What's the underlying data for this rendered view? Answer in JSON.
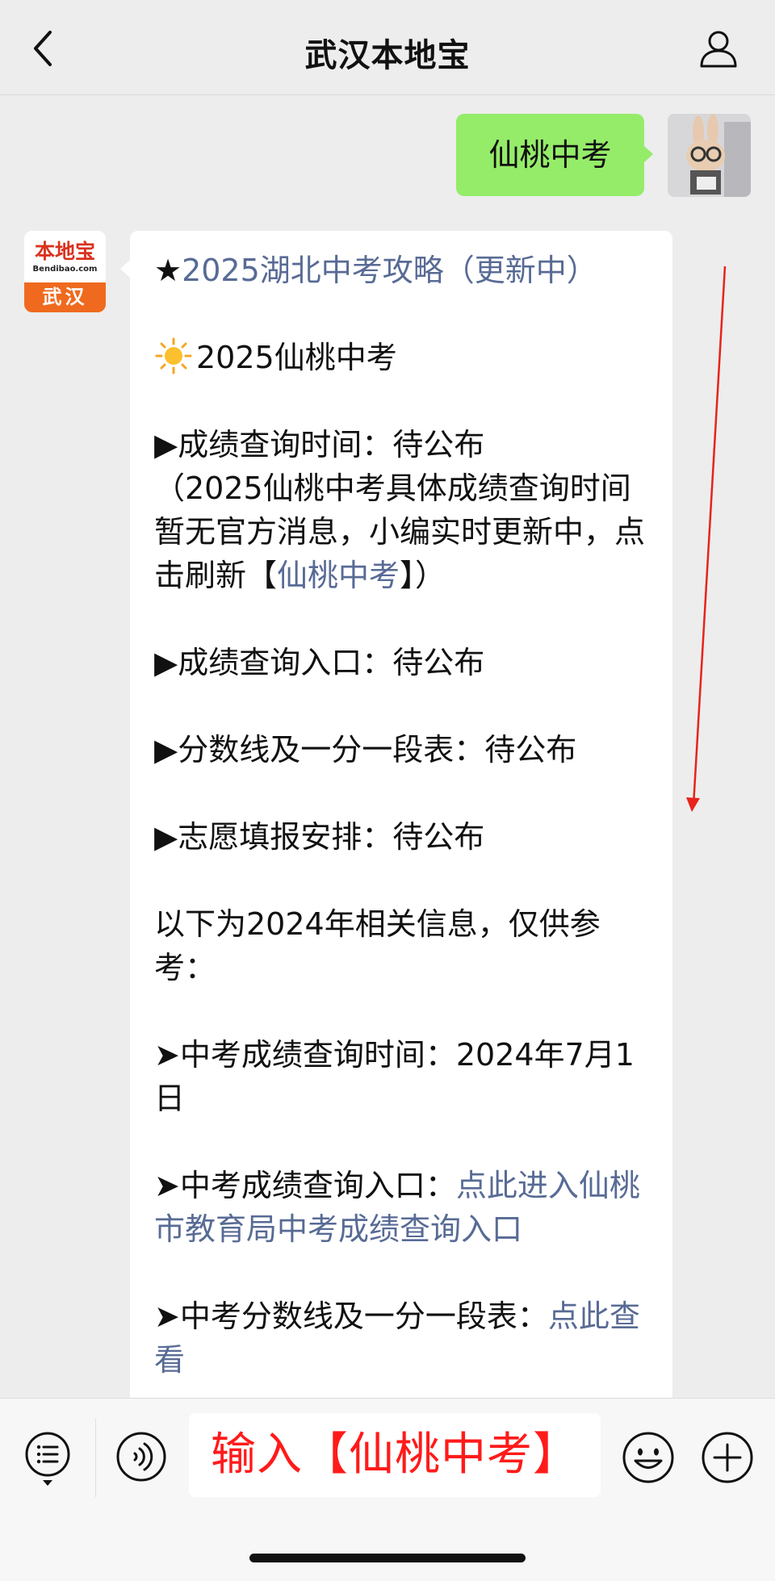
{
  "header": {
    "title": "武汉本地宝"
  },
  "outgoing": {
    "text": "仙桃中考"
  },
  "sender": {
    "brand": "本地宝",
    "url": "Bendibao.com",
    "city": "武汉"
  },
  "message": {
    "star": "★",
    "guide_link": "2025湖北中考攻略（更新中）",
    "heading": "2025仙桃中考",
    "score_time_label": "▶成绩查询时间：待公布",
    "score_time_note_before": "（2025仙桃中考具体成绩查询时间暂无官方消息，小编实时更新中，点击刷新【",
    "score_time_note_link": "仙桃中考",
    "score_time_note_after": "】）",
    "score_entry": "▶成绩查询入口：待公布",
    "cutoff": "▶分数线及一分一段表：待公布",
    "volunteer": "▶志愿填报安排：待公布",
    "ref_note": "以下为2024年相关信息，仅供参考：",
    "last_year_time": "➤中考成绩查询时间：2024年7月1日",
    "last_year_entry_label": "➤中考成绩查询入口：",
    "last_year_entry_link": "点此进入仙桃市教育局中考成绩查询入口",
    "last_year_cutoff_label": "➤中考分数线及一分一段表：",
    "last_year_cutoff_link": "点此查看"
  },
  "input": {
    "hint": "输入【仙桃中考】"
  },
  "icons": {
    "back": "chevron-left-icon",
    "profile": "person-icon",
    "menu": "list-menu-icon",
    "voice": "voice-icon",
    "emoji": "emoji-icon",
    "plus": "plus-icon",
    "sun": "sun-icon"
  },
  "colors": {
    "outgoing_bubble": "#95ec69",
    "link": "#586b95",
    "annotation": "#ff1a1a",
    "brand_orange": "#ef6a1e"
  }
}
